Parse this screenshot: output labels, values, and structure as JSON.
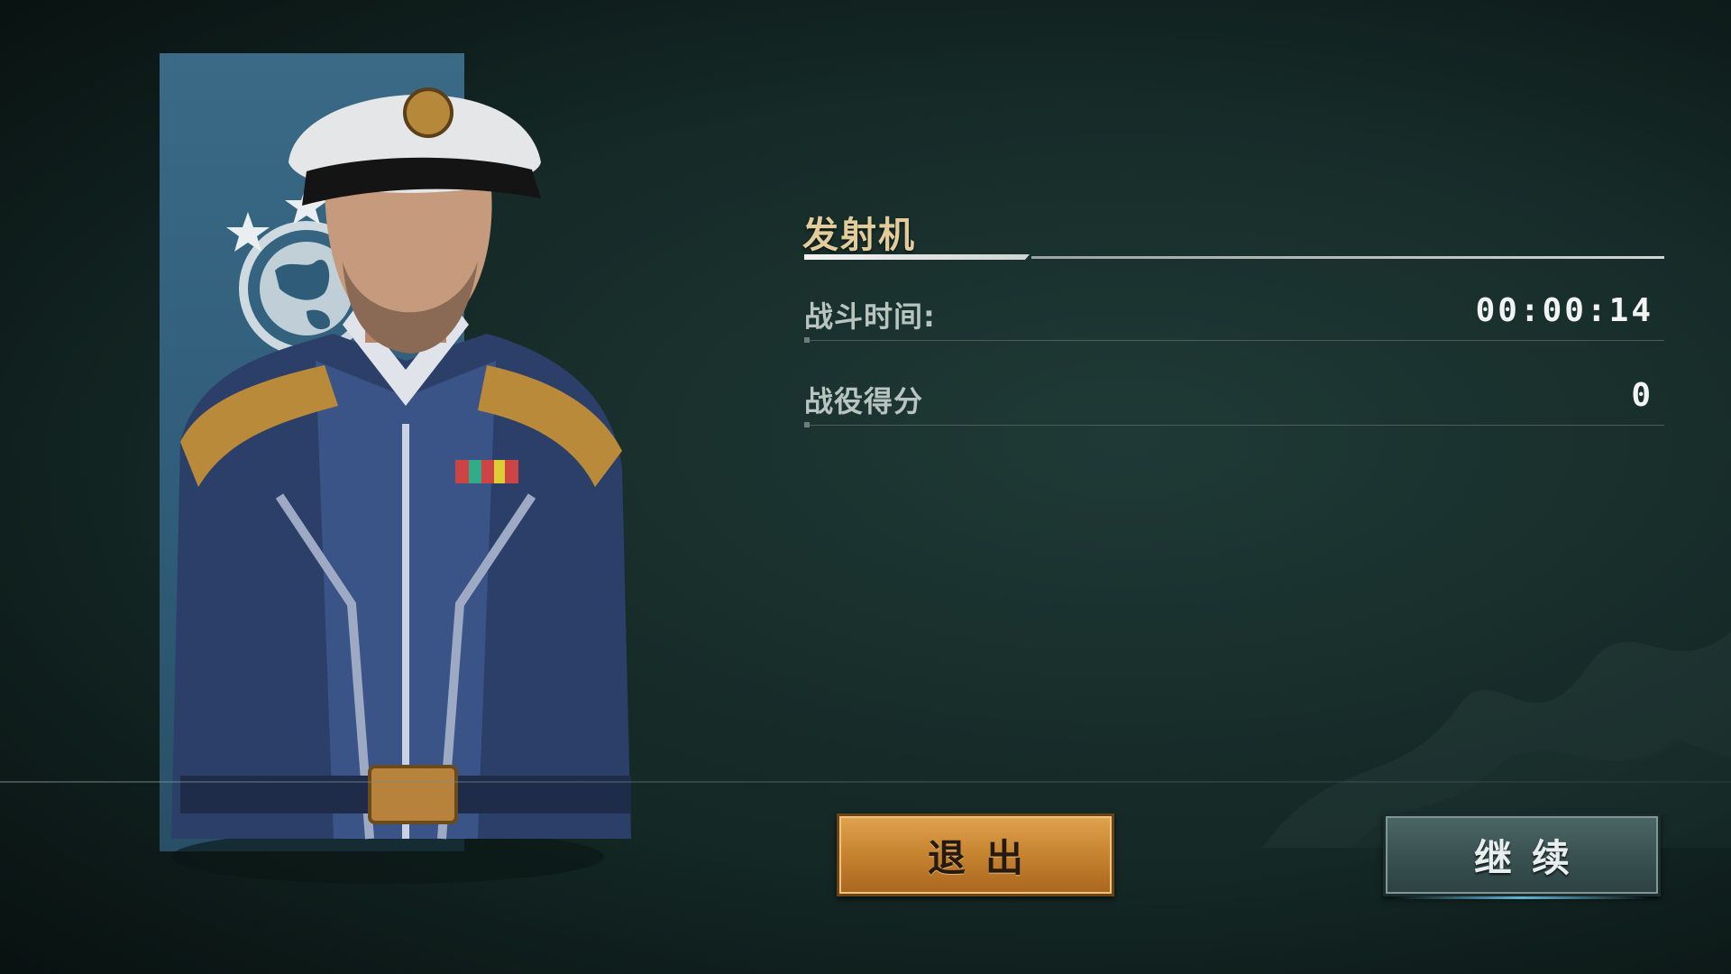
{
  "title": "发射机",
  "stats": [
    {
      "label": "战斗时间:",
      "value": "00:00:14"
    },
    {
      "label": "战役得分",
      "value": "0"
    }
  ],
  "buttons": {
    "exit_label": "退出",
    "continue_label": "继续"
  },
  "colors": {
    "title": "#e2cc9a",
    "exit_button": "#c98632",
    "continue_button": "#3a5252",
    "banner": "#2f5c78"
  },
  "icons": [
    "commander-portrait",
    "globe-stars-emblem"
  ]
}
